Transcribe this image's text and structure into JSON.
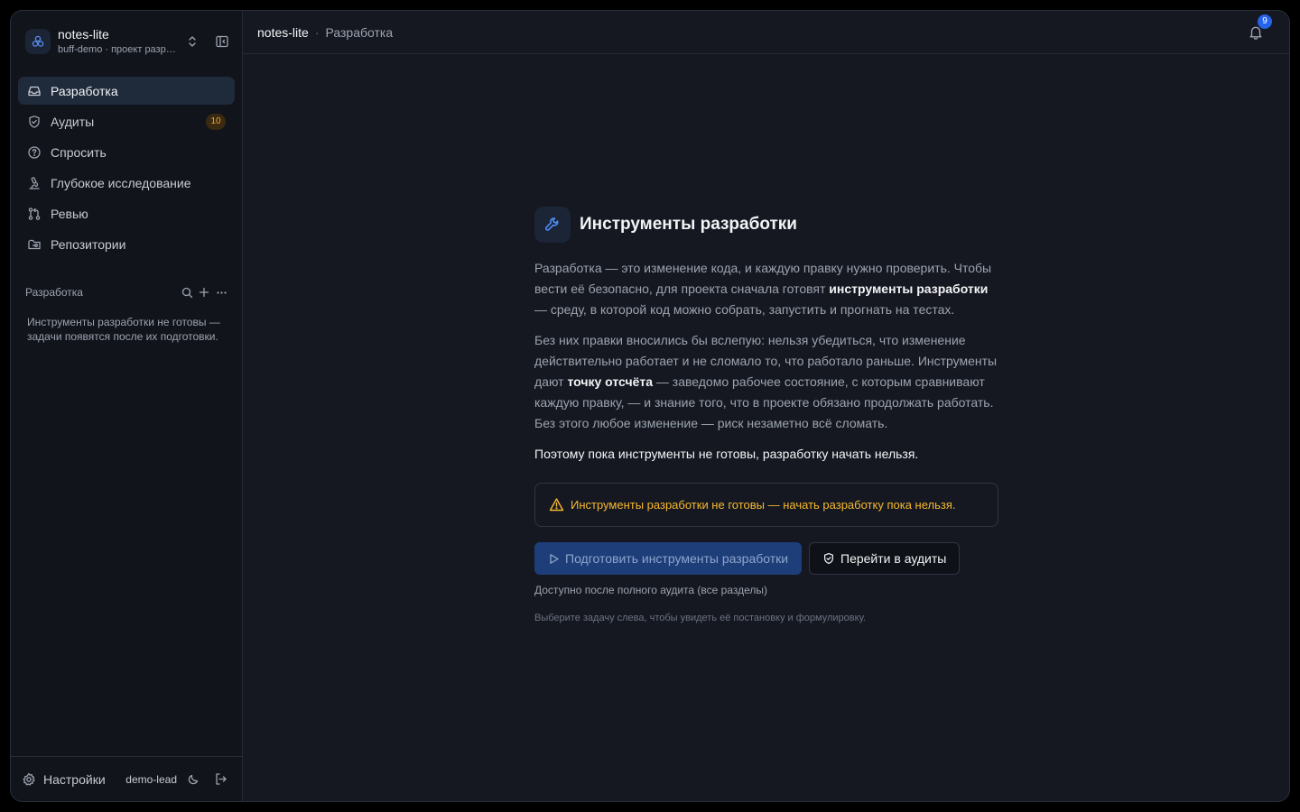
{
  "project": {
    "name": "notes-lite",
    "subtitle": "buff-demo · проект разработки"
  },
  "nav": {
    "items": [
      {
        "label": "Разработка",
        "icon": "inbox-icon",
        "active": true
      },
      {
        "label": "Аудиты",
        "icon": "shield-check-icon",
        "badge": "10"
      },
      {
        "label": "Спросить",
        "icon": "help-circle-icon"
      },
      {
        "label": "Глубокое исследование",
        "icon": "microscope-icon"
      },
      {
        "label": "Ревью",
        "icon": "git-pull-request-icon"
      },
      {
        "label": "Репозитории",
        "icon": "folder-git-icon"
      }
    ]
  },
  "section": {
    "title": "Разработка",
    "empty_text": "Инструменты разработки не готовы — задачи появятся после их подготовки."
  },
  "footer": {
    "settings_label": "Настройки",
    "user": "demo-lead"
  },
  "topbar": {
    "breadcrumb_root": "notes-lite",
    "breadcrumb_sep": "·",
    "breadcrumb_current": "Разработка",
    "notifications_count": "9"
  },
  "main": {
    "title": "Инструменты разработки",
    "para1_a": "Разработка — это изменение кода, и каждую правку нужно проверить. Чтобы вести её безопасно, для проекта сначала готовят ",
    "para1_b": "инструменты разработки",
    "para1_c": " — среду, в которой код можно собрать, запустить и прогнать на тестах.",
    "para2_a": "Без них правки вносились бы вслепую: нельзя убедиться, что изменение действительно работает и не сломало то, что работало раньше. Инструменты дают ",
    "para2_b": "точку отсчёта",
    "para2_c": " — заведомо рабочее состояние, с которым сравнивают каждую правку, — и знание того, что в проекте обязано продолжать работать. Без этого любое изменение — риск незаметно всё сломать.",
    "para3": "Поэтому пока инструменты не готовы, разработку начать нельзя.",
    "alert": "Инструменты разработки не готовы — начать разработку пока нельзя.",
    "primary_button": "Подготовить инструменты разработки",
    "secondary_button": "Перейти в аудиты",
    "note": "Доступно после полного аудита (все разделы)",
    "hint": "Выберите задачу слева, чтобы увидеть её постановку и формулировку."
  },
  "colors": {
    "accent": "#2563eb",
    "warning": "#f5b82e",
    "background": "#151821",
    "sidebar": "#11141b"
  }
}
